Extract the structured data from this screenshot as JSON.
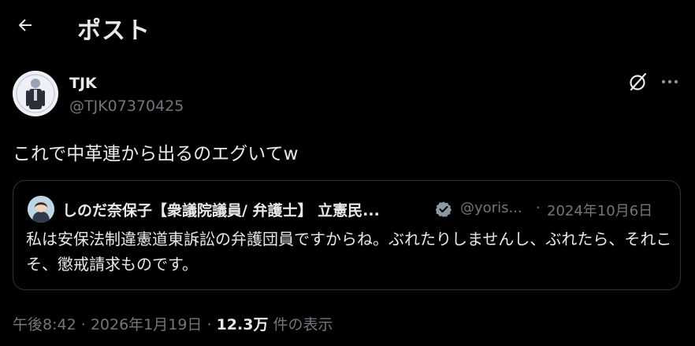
{
  "header": {
    "title": "ポスト"
  },
  "author": {
    "name": "TJK",
    "handle": "@TJK07370425"
  },
  "tweet": {
    "text": "これで中革連から出るのエグいてw"
  },
  "quoted": {
    "name": "しのだ奈保子【衆議院議員/ 弁護士】 立憲民...",
    "handle": "@yoris...",
    "separator": "·",
    "date": "2024年10月6日",
    "text": "私は安保法制違憲道東訴訟の弁護団員ですからね。ぶれたりしませんし、ぶれたら、それこそ、懲戒請求ものです。"
  },
  "meta": {
    "time": "午後8:42",
    "sep1": "·",
    "date": "2026年1月19日",
    "sep2": "·",
    "views": "12.3万",
    "views_label": "件の表示"
  },
  "icons": {
    "back": "arrow-left-icon",
    "grok": "grok-icon",
    "more": "more-icon",
    "verified": "verified-badge-icon"
  },
  "colors": {
    "background": "#000000",
    "text": "#e7e9ea",
    "secondary": "#71767b",
    "border": "#2f3336"
  }
}
